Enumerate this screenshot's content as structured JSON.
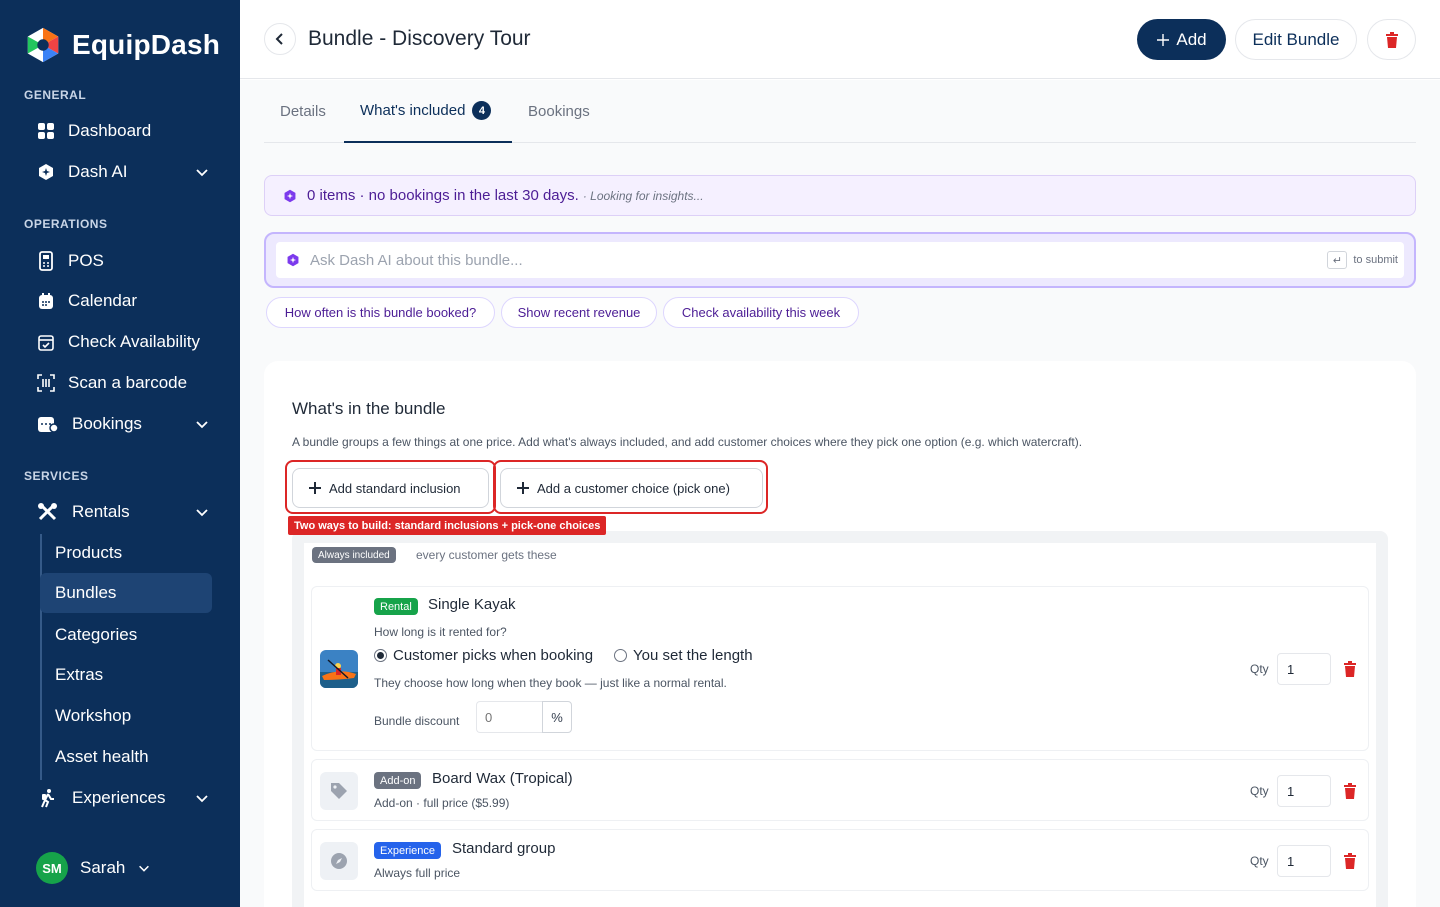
{
  "brand": {
    "name": "EquipDash"
  },
  "sidebar": {
    "sections": {
      "general": "GENERAL",
      "operations": "OPERATIONS",
      "services": "SERVICES"
    },
    "items": {
      "dashboard": "Dashboard",
      "dash_ai": "Dash AI",
      "pos": "POS",
      "calendar": "Calendar",
      "check_availability": "Check Availability",
      "scan_barcode": "Scan a barcode",
      "bookings": "Bookings",
      "rentals": "Rentals",
      "experiences": "Experiences"
    },
    "rentals_sub": [
      "Products",
      "Bundles",
      "Categories",
      "Extras",
      "Workshop",
      "Asset health"
    ],
    "user": {
      "initials": "SM",
      "name": "Sarah"
    }
  },
  "header": {
    "title": "Bundle - Discovery Tour",
    "add_label": "Add",
    "edit_label": "Edit Bundle"
  },
  "tabs": {
    "details": "Details",
    "included": "What's included",
    "included_count": "4",
    "bookings": "Bookings"
  },
  "insight": {
    "text": "0 items · no bookings in the last 30 days.",
    "sub": "· Looking for insights..."
  },
  "ask": {
    "placeholder": "Ask Dash AI about this bundle...",
    "hint": "to submit",
    "chips": [
      "How often is this bundle booked?",
      "Show recent revenue",
      "Check availability this week"
    ]
  },
  "bundle": {
    "title": "What's in the bundle",
    "description": "A bundle groups a few things at one price. Add what's always included, and add customer choices where they pick one option (e.g. which watercraft).",
    "add_standard": "Add standard inclusion",
    "add_choice": "Add a customer choice (pick one)",
    "annotation": "Two ways to build: standard inclusions + pick-one choices",
    "always_tag": "Always included",
    "always_note": "every customer gets these",
    "qty_label": "Qty",
    "items": [
      {
        "type": "Rental",
        "name": "Single Kayak",
        "question": "How long is it rented for?",
        "option_a": "Customer picks when booking",
        "option_b": "You set the length",
        "note": "They choose how long when they book — just like a normal rental.",
        "discount_label": "Bundle discount",
        "discount_placeholder": "0",
        "discount_unit": "%",
        "qty": "1"
      },
      {
        "type": "Add-on",
        "name": "Board Wax (Tropical)",
        "sub": "Add-on · full price ($5.99)",
        "qty": "1"
      },
      {
        "type": "Experience",
        "name": "Standard group",
        "sub": "Always full price",
        "qty": "1"
      }
    ]
  },
  "colors": {
    "sidebar": "#0c2f5a",
    "primary": "#0c2f5a",
    "rental": "#16a34a",
    "addon": "#6b7280",
    "experience": "#2563eb",
    "danger": "#dc2626",
    "ai": "#7c3aed"
  }
}
